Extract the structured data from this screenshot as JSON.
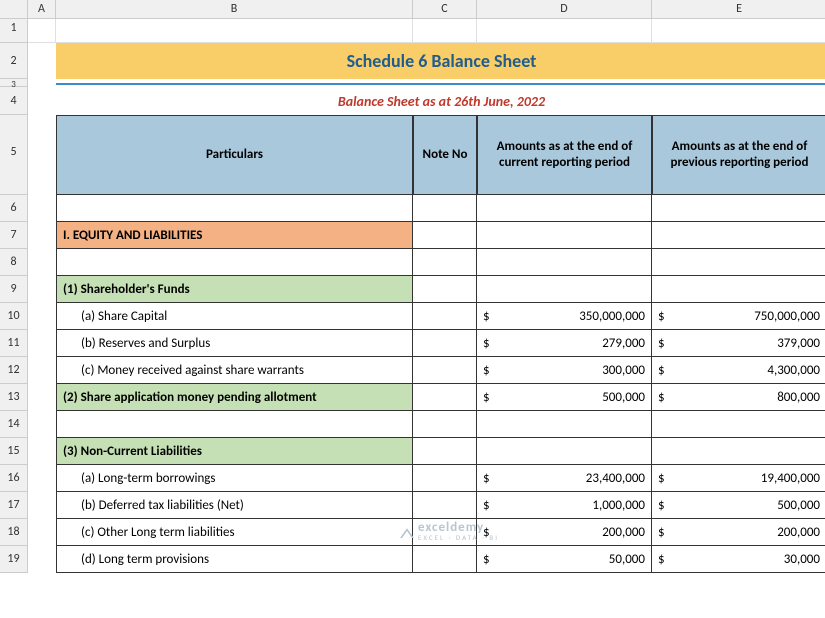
{
  "columns": [
    "A",
    "B",
    "C",
    "D",
    "E"
  ],
  "rows": [
    "1",
    "2",
    "3",
    "4",
    "5",
    "6",
    "7",
    "8",
    "9",
    "10",
    "11",
    "12",
    "13",
    "14",
    "15",
    "16",
    "17",
    "18",
    "19"
  ],
  "title": "Schedule 6 Balance Sheet",
  "subtitle": "Balance Sheet as at 26th June, 2022",
  "headers": {
    "particulars": "Particulars",
    "note_no": "Note No",
    "current": "Amounts as at the end of current reporting period",
    "previous": "Amounts as at the end of previous reporting period"
  },
  "watermark": {
    "main": "exceldemy",
    "sub": "EXCEL · DATA · BI"
  },
  "lines": [
    {
      "type": "blank"
    },
    {
      "type": "section_orange",
      "label": "I. EQUITY AND LIABILITIES"
    },
    {
      "type": "blank"
    },
    {
      "type": "section_green",
      "label": "(1) Shareholder's Funds"
    },
    {
      "type": "item",
      "label": "(a) Share Capital",
      "current": "350,000,000",
      "previous": "750,000,000"
    },
    {
      "type": "item",
      "label": "(b) Reserves and Surplus",
      "current": "279,000",
      "previous": "379,000"
    },
    {
      "type": "item",
      "label": "(c) Money received against share warrants",
      "current": "300,000",
      "previous": "4,300,000"
    },
    {
      "type": "section_green_amt",
      "label": "(2) Share application money pending allotment",
      "current": "500,000",
      "previous": "800,000"
    },
    {
      "type": "blank"
    },
    {
      "type": "section_green",
      "label": "(3) Non-Current Liabilities"
    },
    {
      "type": "item",
      "label": "(a) Long-term borrowings",
      "current": "23,400,000",
      "previous": "19,400,000"
    },
    {
      "type": "item",
      "label": "(b) Deferred tax liabilities (Net)",
      "current": "1,000,000",
      "previous": "500,000"
    },
    {
      "type": "item",
      "label": "(c) Other Long term liabilities",
      "current": "200,000",
      "previous": "200,000"
    },
    {
      "type": "item",
      "label": "(d) Long term provisions",
      "current": "50,000",
      "previous": "30,000"
    }
  ]
}
